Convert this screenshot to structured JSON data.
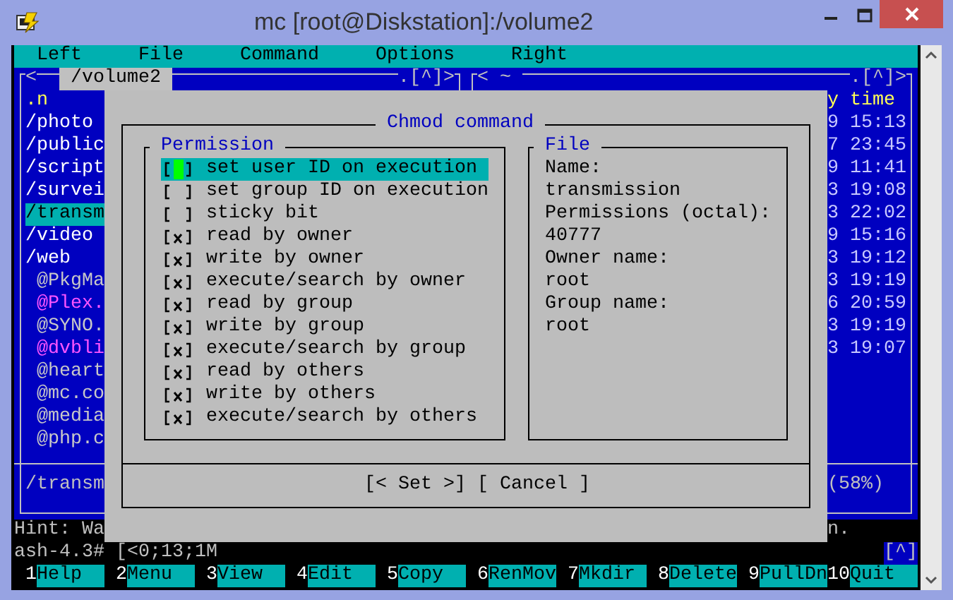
{
  "window": {
    "title": "mc [root@Diskstation]:/volume2"
  },
  "menu_bar": [
    {
      "label": "Left"
    },
    {
      "label": "File"
    },
    {
      "label": "Command"
    },
    {
      "label": "Options"
    },
    {
      "label": "Right"
    }
  ],
  "left_panel": {
    "left_marker": "<",
    "path": "/volume2",
    "right_marker": ".[^]>",
    "items": [
      {
        "name": ".n",
        "kind": "highlighted",
        "selected": false
      },
      {
        "name": "/photo",
        "kind": "dir",
        "selected": false
      },
      {
        "name": "/public",
        "kind": "dir",
        "selected": false
      },
      {
        "name": "/script",
        "kind": "dir",
        "selected": false
      },
      {
        "name": "/survei",
        "kind": "dir",
        "selected": false
      },
      {
        "name": "/transm",
        "kind": "dir",
        "selected": true
      },
      {
        "name": "/video",
        "kind": "dir",
        "selected": false
      },
      {
        "name": "/web",
        "kind": "dir",
        "selected": false
      },
      {
        "name": "@PkgMa",
        "kind": "link",
        "selected": false
      },
      {
        "name": "@Plex.",
        "kind": "broken",
        "selected": false
      },
      {
        "name": "@SYNO.",
        "kind": "link",
        "selected": false
      },
      {
        "name": "@dvbli",
        "kind": "broken",
        "selected": false
      },
      {
        "name": "@heart",
        "kind": "link",
        "selected": false
      },
      {
        "name": "@mc.co",
        "kind": "link",
        "selected": false
      },
      {
        "name": "@media",
        "kind": "link",
        "selected": false
      },
      {
        "name": "@php.c",
        "kind": "link",
        "selected": false
      }
    ],
    "footer": "/transm"
  },
  "right_panel": {
    "left_marker": "<",
    "path": "~",
    "right_marker": ".[^]>",
    "heading": "y time",
    "rows": [
      "9 15:13",
      "7 23:45",
      "9 11:41",
      "3 19:08",
      "3 22:02",
      "9 15:16",
      "3 19:12",
      "3 19:19",
      "6 20:59",
      "3 19:19",
      "3 19:07"
    ],
    "footer": "(58%)"
  },
  "dialog": {
    "title": "Chmod command",
    "permission_group": {
      "title": "Permission",
      "items": [
        {
          "label": "set user ID on execution",
          "checked": false,
          "selected": true
        },
        {
          "label": "set group ID on execution",
          "checked": false,
          "selected": false
        },
        {
          "label": "sticky bit",
          "checked": false,
          "selected": false
        },
        {
          "label": "read by owner",
          "checked": true,
          "selected": false
        },
        {
          "label": "write by owner",
          "checked": true,
          "selected": false
        },
        {
          "label": "execute/search by owner",
          "checked": true,
          "selected": false
        },
        {
          "label": "read by group",
          "checked": true,
          "selected": false
        },
        {
          "label": "write by group",
          "checked": true,
          "selected": false
        },
        {
          "label": "execute/search by group",
          "checked": true,
          "selected": false
        },
        {
          "label": "read by others",
          "checked": true,
          "selected": false
        },
        {
          "label": "write by others",
          "checked": true,
          "selected": false
        },
        {
          "label": "execute/search by others",
          "checked": true,
          "selected": false
        }
      ]
    },
    "file_group": {
      "title": "File",
      "lines": [
        "Name:",
        "transmission",
        "Permissions (octal):",
        "40777",
        "Owner name:",
        "root",
        "Group name:",
        "root"
      ]
    },
    "buttons": [
      {
        "label": "[< Set >]"
      },
      {
        "label": "[ Cancel ]"
      }
    ]
  },
  "hint": {
    "text": "Hint: Wa",
    "tail": "n."
  },
  "command_line": {
    "prompt": "ash-4.3#",
    "text": "[<0;13;1M",
    "corner": "[^]"
  },
  "function_keys": [
    {
      "number": "1",
      "label": "Help"
    },
    {
      "number": "2",
      "label": "Menu"
    },
    {
      "number": "3",
      "label": "View"
    },
    {
      "number": "4",
      "label": "Edit"
    },
    {
      "number": "5",
      "label": "Copy"
    },
    {
      "number": "6",
      "label": "RenMov"
    },
    {
      "number": "7",
      "label": "Mkdir"
    },
    {
      "number": "8",
      "label": "Delete"
    },
    {
      "number": "9",
      "label": "PullDn"
    },
    {
      "number": "10",
      "label": "Quit"
    }
  ]
}
